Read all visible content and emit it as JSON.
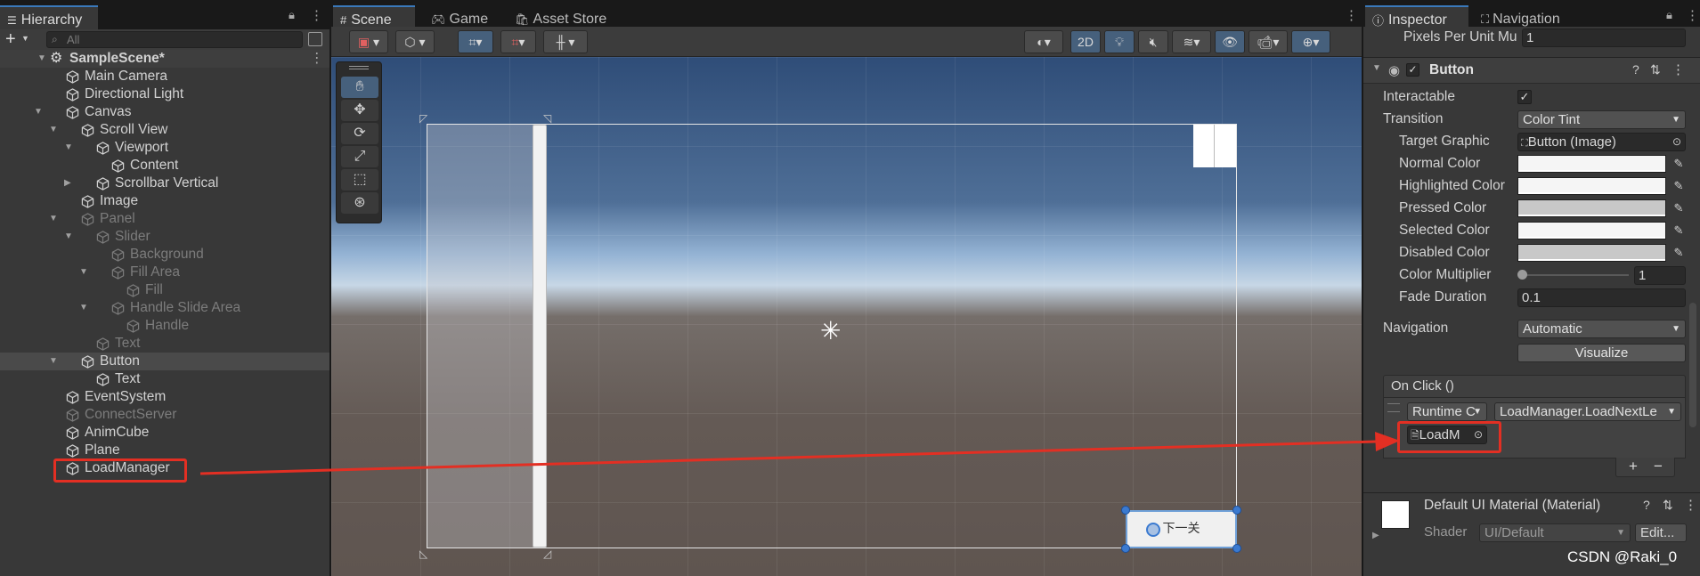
{
  "hierarchy": {
    "tab_title": "Hierarchy",
    "add_label": "+",
    "search_placeholder": "All",
    "scene_name": "SampleScene*",
    "rows": [
      {
        "label": "Main Camera",
        "depth": 1,
        "arrow": "",
        "dim": false
      },
      {
        "label": "Directional Light",
        "depth": 1,
        "arrow": "",
        "dim": false
      },
      {
        "label": "Canvas",
        "depth": 1,
        "arrow": "down",
        "dim": false
      },
      {
        "label": "Scroll View",
        "depth": 2,
        "arrow": "down",
        "dim": false
      },
      {
        "label": "Viewport",
        "depth": 3,
        "arrow": "down",
        "dim": false
      },
      {
        "label": "Content",
        "depth": 4,
        "arrow": "",
        "dim": false
      },
      {
        "label": "Scrollbar Vertical",
        "depth": 3,
        "arrow": "right",
        "dim": false
      },
      {
        "label": "Image",
        "depth": 2,
        "arrow": "",
        "dim": false
      },
      {
        "label": "Panel",
        "depth": 2,
        "arrow": "down",
        "dim": true
      },
      {
        "label": "Slider",
        "depth": 3,
        "arrow": "down",
        "dim": true
      },
      {
        "label": "Background",
        "depth": 4,
        "arrow": "",
        "dim": true
      },
      {
        "label": "Fill Area",
        "depth": 4,
        "arrow": "down",
        "dim": true
      },
      {
        "label": "Fill",
        "depth": 5,
        "arrow": "",
        "dim": true
      },
      {
        "label": "Handle Slide Area",
        "depth": 4,
        "arrow": "down",
        "dim": true
      },
      {
        "label": "Handle",
        "depth": 5,
        "arrow": "",
        "dim": true
      },
      {
        "label": "Text",
        "depth": 3,
        "arrow": "",
        "dim": true
      },
      {
        "label": "Button",
        "depth": 2,
        "arrow": "down",
        "dim": false,
        "selected": true
      },
      {
        "label": "Text",
        "depth": 3,
        "arrow": "",
        "dim": false
      },
      {
        "label": "EventSystem",
        "depth": 1,
        "arrow": "",
        "dim": false
      },
      {
        "label": "ConnectServer",
        "depth": 1,
        "arrow": "",
        "dim": true
      },
      {
        "label": "AnimCube",
        "depth": 1,
        "arrow": "",
        "dim": false
      },
      {
        "label": "Plane",
        "depth": 1,
        "arrow": "",
        "dim": false
      },
      {
        "label": "LoadManager",
        "depth": 1,
        "arrow": "",
        "dim": false
      }
    ]
  },
  "scene": {
    "tabs": [
      "Scene",
      "Game",
      "Asset Store"
    ],
    "mode_2d": "2D",
    "button_text": "下一关"
  },
  "inspector": {
    "tabs": [
      "Inspector",
      "Navigation"
    ],
    "pixels_per_unit_label": "Pixels Per Unit Mu",
    "pixels_per_unit_value": "1",
    "component_title": "Button",
    "interactable_label": "Interactable",
    "transition_label": "Transition",
    "transition_value": "Color Tint",
    "target_graphic_label": "Target Graphic",
    "target_graphic_value": "Button (Image)",
    "colors": [
      {
        "label": "Normal Color",
        "color": "#f5f5f5"
      },
      {
        "label": "Highlighted Color",
        "color": "#f5f5f5"
      },
      {
        "label": "Pressed Color",
        "color": "#c8c8c8"
      },
      {
        "label": "Selected Color",
        "color": "#f5f5f5"
      },
      {
        "label": "Disabled Color",
        "color": "#c8c8c8"
      }
    ],
    "color_multiplier_label": "Color Multiplier",
    "color_multiplier_value": "1",
    "fade_duration_label": "Fade Duration",
    "fade_duration_value": "0.1",
    "navigation_label": "Navigation",
    "navigation_value": "Automatic",
    "visualize_label": "Visualize",
    "onclick_label": "On Click ()",
    "runtime_value": "Runtime C",
    "function_value": "LoadManager.LoadNextLe",
    "object_value": "LoadM",
    "plus_label": "+",
    "minus_label": "−",
    "material_title": "Default UI Material (Material)",
    "shader_label": "Shader",
    "shader_value": "UI/Default",
    "edit_label": "Edit..."
  },
  "watermark": "CSDN @Raki_0",
  "accent": "#e32f23"
}
